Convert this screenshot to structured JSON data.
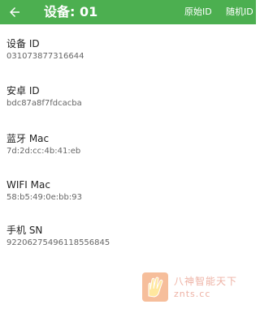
{
  "colors": {
    "accent": "#4caf50",
    "appbar_text": "#ffffff",
    "label": "#222222",
    "value": "#666666"
  },
  "appbar": {
    "back_icon": "arrow-left-icon",
    "title": "设备: 01",
    "actions": [
      "原始ID",
      "随机ID"
    ]
  },
  "items": [
    {
      "label": "设备 ID",
      "value": "031073877316644"
    },
    {
      "label": "安卓 ID",
      "value": "bdc87a8f7fdcacba"
    },
    {
      "label": "蓝牙 Mac",
      "value": "7d:2d:cc:4b:41:eb"
    },
    {
      "label": "WIFI Mac",
      "value": "58:b5:49:0e:bb:93"
    },
    {
      "label": "手机 SN",
      "value": "92206275496118556845"
    }
  ],
  "watermark": {
    "icon": "hand-logo-icon",
    "line1": "八神智能天下",
    "line2": "znts.cc"
  }
}
